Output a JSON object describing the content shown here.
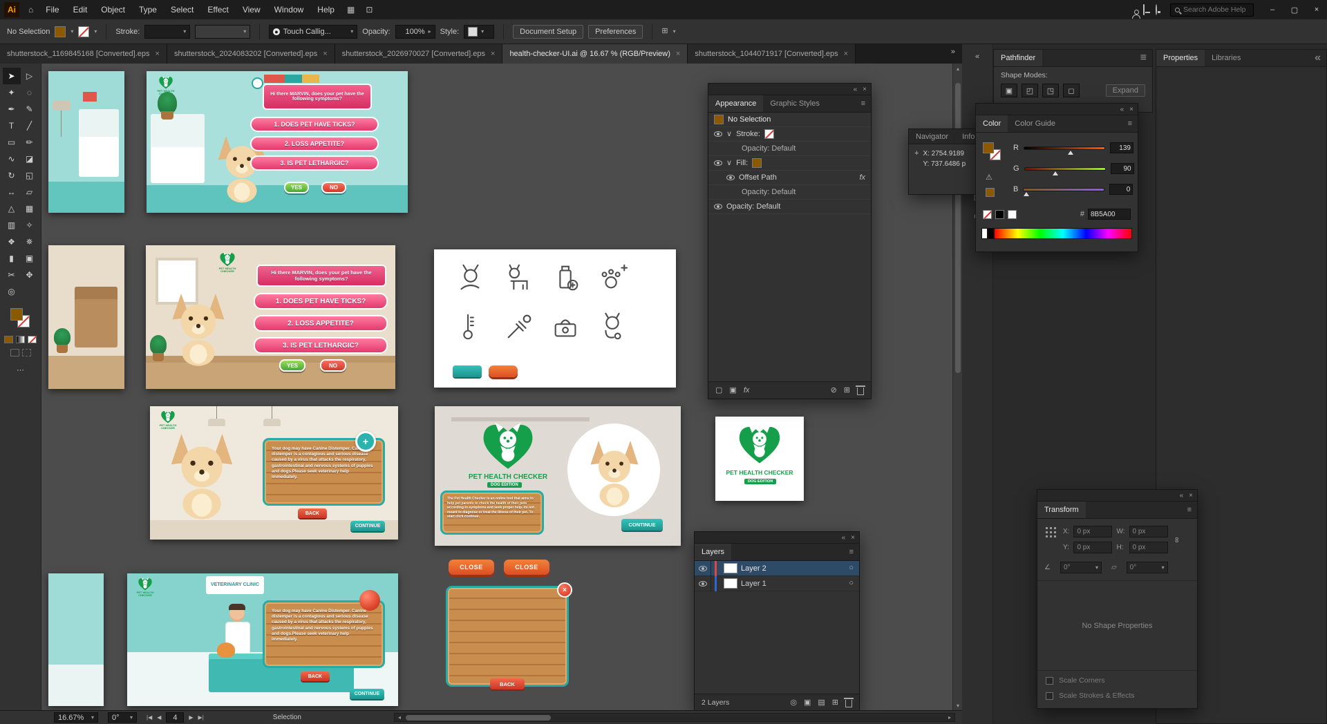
{
  "menubar": {
    "app_icon": "Ai",
    "menus": [
      "File",
      "Edit",
      "Object",
      "Type",
      "Select",
      "Effect",
      "View",
      "Window",
      "Help"
    ],
    "search_placeholder": "Search Adobe Help"
  },
  "control_bar": {
    "no_selection": "No Selection",
    "stroke_label": "Stroke:",
    "brush_name": "Touch Callig...",
    "opacity_label": "Opacity:",
    "opacity_value": "100%",
    "style_label": "Style:",
    "document_setup_label": "Document Setup",
    "preferences_label": "Preferences"
  },
  "tab_bar": {
    "tabs": [
      {
        "label": "shutterstock_1169845168 [Converted].eps"
      },
      {
        "label": "shutterstock_2024083202 [Converted].eps"
      },
      {
        "label": "shutterstock_2026970027 [Converted].eps"
      },
      {
        "label": "health-checker-UI.ai @ 16.67 % (RGB/Preview)"
      },
      {
        "label": "shutterstock_1044071917 [Converted].eps"
      }
    ]
  },
  "toolbar": {
    "tools": [
      {
        "name": "selection-tool",
        "glyph": "➤"
      },
      {
        "name": "direct-selection-tool",
        "glyph": "▷"
      },
      {
        "name": "magic-wand-tool",
        "glyph": "✦"
      },
      {
        "name": "lasso-tool",
        "glyph": "◌"
      },
      {
        "name": "pen-tool",
        "glyph": "✒"
      },
      {
        "name": "curvature-tool",
        "glyph": "✎"
      },
      {
        "name": "type-tool",
        "glyph": "T"
      },
      {
        "name": "line-segment-tool",
        "glyph": "╱"
      },
      {
        "name": "rectangle-tool",
        "glyph": "▭"
      },
      {
        "name": "paintbrush-tool",
        "glyph": "✏"
      },
      {
        "name": "shaper-tool",
        "glyph": "∿"
      },
      {
        "name": "eraser-tool",
        "glyph": "◪"
      },
      {
        "name": "rotate-tool",
        "glyph": "↻"
      },
      {
        "name": "scale-tool",
        "glyph": "◱"
      },
      {
        "name": "width-tool",
        "glyph": "↔"
      },
      {
        "name": "free-transform-tool",
        "glyph": "▱"
      },
      {
        "name": "perspective-grid-tool",
        "glyph": "△"
      },
      {
        "name": "mesh-tool",
        "glyph": "▦"
      },
      {
        "name": "gradient-tool",
        "glyph": "▥"
      },
      {
        "name": "eyedropper-tool",
        "glyph": "✧"
      },
      {
        "name": "blend-tool",
        "glyph": "❖"
      },
      {
        "name": "symbol-sprayer-tool",
        "glyph": "✵"
      },
      {
        "name": "column-graph-tool",
        "glyph": "▮"
      },
      {
        "name": "artboard-tool",
        "glyph": "▣"
      },
      {
        "name": "slice-tool",
        "glyph": "✂"
      },
      {
        "name": "hand-tool",
        "glyph": "✥"
      },
      {
        "name": "zoom-tool",
        "glyph": "◎"
      }
    ]
  },
  "screens": {
    "greeting": "Hi there MARVIN, does your pet have the following symptoms?",
    "symptom_1": "1. DOES PET HAVE TICKS?",
    "symptom_2": "2. LOSS APPETITE?",
    "symptom_3": "3. IS PET LETHARGIC?",
    "yes_label": "YES",
    "no_label": "NO",
    "distemper_text": "Your dog may have Canine Distemper. Canine distemper is a contagious and serious disease caused by a virus that attacks the respiratory, gastrointestinal and nervous systems of puppies and dogs.Please seek veterinary help immediately.",
    "back_label": "BACK",
    "continue_label": "CONTINUE",
    "close_label": "CLOSE",
    "logo_title": "PET HEALTH CHECKER",
    "logo_edition": "DOG EDITION",
    "intro_text": "The Pet Health Checker is an online tool that aims to help pet parents to check the health of their pets according to symptoms and seek proper help. Its not meant to diagnose or treat the illness of their pet. To start click continue.",
    "clinic_sign": "VETERINARY CLINIC",
    "plus_glyph": "+"
  },
  "panels": {
    "appearance": {
      "tab_active": "Appearance",
      "tab_inactive": "Graphic Styles",
      "no_selection": "No Selection",
      "stroke_label": "Stroke:",
      "opacity_default": "Opacity: Default",
      "fill_label": "Fill:",
      "offset_path": "Offset Path"
    },
    "navigator": {
      "tab1": "Navigator",
      "tab2": "Info",
      "x_label": "X:",
      "x_value": "2754.9189",
      "y_label": "Y:",
      "y_value": "737.6486 p"
    },
    "color": {
      "tab1": "Color",
      "tab2": "Color Guide",
      "r_label": "R",
      "r_value": "139",
      "g_label": "G",
      "g_value": "90",
      "b_label": "B",
      "b_value": "0",
      "hex_prefix": "#",
      "hex_value": "8B5A00"
    },
    "pathfinder": {
      "title": "Pathfinder",
      "shape_modes_label": "Shape Modes:",
      "expand_label": "Expand"
    },
    "properties": {
      "tab1": "Properties",
      "tab2": "Libraries"
    },
    "layers": {
      "title": "Layers",
      "layer_2": "Layer 2",
      "layer_1": "Layer 1",
      "count_label": "2 Layers"
    },
    "transform": {
      "title": "Transform",
      "x_label": "X:",
      "y_label": "Y:",
      "w_label": "W:",
      "h_label": "H:",
      "x_value": "0 px",
      "y_value": "0 px",
      "w_value": "0 px",
      "h_value": "0 px",
      "rotate_value": "0°",
      "shear_value": "0°",
      "empty_label": "No Shape Properties",
      "scale_corners_label": "Scale Corners",
      "scale_strokes_label": "Scale Strokes & Effects"
    }
  },
  "status_bar": {
    "zoom_value": "16.67%",
    "rotation_value": "0°",
    "artboard_value": "4",
    "tool_label": "Selection"
  },
  "ui": {
    "caret_down": "▾",
    "caret_up": "▴",
    "caret_right": "▸",
    "caret_left": "◂",
    "chevron_down": "∨",
    "menu": "≡",
    "collapse": "«",
    "overflow": "»",
    "close": "×",
    "minimize": "–",
    "maximize": "▢",
    "home": "⌂",
    "dot": "●",
    "plus": "+",
    "fx": "fx",
    "warning": "⚠",
    "target_circle": "○",
    "ellipsis": "⋯",
    "nav_first": "|◀",
    "nav_prev": "◀",
    "nav_next": "▶",
    "nav_last": "▶|",
    "link": "∞",
    "clear": "⊘",
    "new_item": "⊞",
    "add_stroke": "▢",
    "add_fill": "▣",
    "locate": "◎",
    "mask": "▣",
    "sublayer": "▤",
    "angle": "∠",
    "shear": "▱",
    "pf_unite": "▣",
    "pf_minus": "◰",
    "pf_intersect": "◳",
    "pf_exclude": "◻",
    "arrange": "▦",
    "share": "⊡",
    "dock1": "◧",
    "dock2": "▤",
    "dock3": "▣",
    "dock4": "◎"
  },
  "colors": {
    "accent_fill": "#8B5A00",
    "logo_green": "#169f4a",
    "ui_teal": "#29b6af",
    "dialog_pink": "#e8386d"
  }
}
